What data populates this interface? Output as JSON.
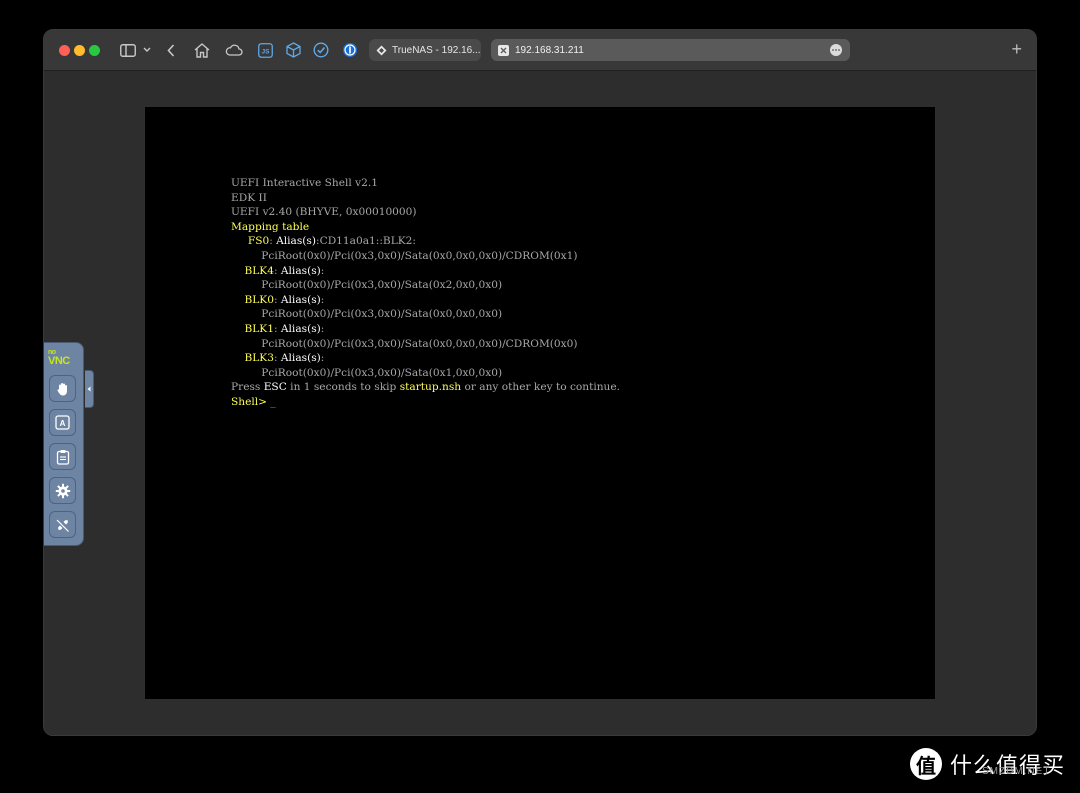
{
  "browser": {
    "tab": {
      "title": "TrueNAS - 192.16..."
    },
    "url": "192.168.31.211",
    "toolbar_icons": [
      "sidebar-icon",
      "chevron-down-icon",
      "back-icon",
      "home-icon",
      "cloud-icon",
      "js-extension-icon",
      "cube-extension-icon",
      "check-extension-icon",
      "password-extension-icon"
    ],
    "new_tab_label": "+"
  },
  "console": {
    "lines": [
      [
        {
          "t": "UEFI Interactive Shell v2.1",
          "c": "g"
        }
      ],
      [
        {
          "t": "EDK II",
          "c": "g"
        }
      ],
      [
        {
          "t": "UEFI v2.40 (BHYVE, 0x00010000)",
          "c": "g"
        }
      ],
      [
        {
          "t": "Mapping table",
          "c": "y"
        }
      ],
      [
        {
          "t": "     FS0",
          "c": "y"
        },
        {
          "t": ": ",
          "c": "g"
        },
        {
          "t": "Alias(s)",
          "c": "w"
        },
        {
          "t": ":CD11a0a1::BLK2:",
          "c": "g"
        }
      ],
      [
        {
          "t": "         PciRoot(0x0)/Pci(0x3,0x0)/Sata(0x0,0x0,0x0)/CDROM(0x1)",
          "c": "g"
        }
      ],
      [
        {
          "t": "    BLK4",
          "c": "y"
        },
        {
          "t": ": ",
          "c": "g"
        },
        {
          "t": "Alias(s)",
          "c": "w"
        },
        {
          "t": ":",
          "c": "g"
        }
      ],
      [
        {
          "t": "         PciRoot(0x0)/Pci(0x3,0x0)/Sata(0x2,0x0,0x0)",
          "c": "g"
        }
      ],
      [
        {
          "t": "    BLK0",
          "c": "y"
        },
        {
          "t": ": ",
          "c": "g"
        },
        {
          "t": "Alias(s)",
          "c": "w"
        },
        {
          "t": ":",
          "c": "g"
        }
      ],
      [
        {
          "t": "         PciRoot(0x0)/Pci(0x3,0x0)/Sata(0x0,0x0,0x0)",
          "c": "g"
        }
      ],
      [
        {
          "t": "    BLK1",
          "c": "y"
        },
        {
          "t": ": ",
          "c": "g"
        },
        {
          "t": "Alias(s)",
          "c": "w"
        },
        {
          "t": ":",
          "c": "g"
        }
      ],
      [
        {
          "t": "         PciRoot(0x0)/Pci(0x3,0x0)/Sata(0x0,0x0,0x0)/CDROM(0x0)",
          "c": "g"
        }
      ],
      [
        {
          "t": "    BLK3",
          "c": "y"
        },
        {
          "t": ": ",
          "c": "g"
        },
        {
          "t": "Alias(s)",
          "c": "w"
        },
        {
          "t": ":",
          "c": "g"
        }
      ],
      [
        {
          "t": "         PciRoot(0x0)/Pci(0x3,0x0)/Sata(0x1,0x0,0x0)",
          "c": "g"
        }
      ],
      [
        {
          "t": "Press ",
          "c": "g"
        },
        {
          "t": "ESC",
          "c": "w"
        },
        {
          "t": " in 1 seconds to skip ",
          "c": "g"
        },
        {
          "t": "startup.nsh",
          "c": "y"
        },
        {
          "t": " or any other key to continue.",
          "c": "g"
        }
      ],
      [
        {
          "t": "Shell> ",
          "c": "y"
        },
        {
          "t": "_",
          "c": "g"
        }
      ]
    ]
  },
  "novnc": {
    "logo_top": "no",
    "logo_bottom": "VNC",
    "buttons": [
      "drag-hand-icon",
      "keyboard-icon",
      "clipboard-icon",
      "settings-icon",
      "disconnect-icon"
    ]
  },
  "watermark": {
    "logo": "值",
    "text": "什么值得买",
    "sub": "SMZDM.NET"
  },
  "colors": {
    "console_gray": "#a8a8a8",
    "console_yellow": "#ffff55",
    "console_white": "#ffffff",
    "novnc_panel": "#6e84a3"
  }
}
